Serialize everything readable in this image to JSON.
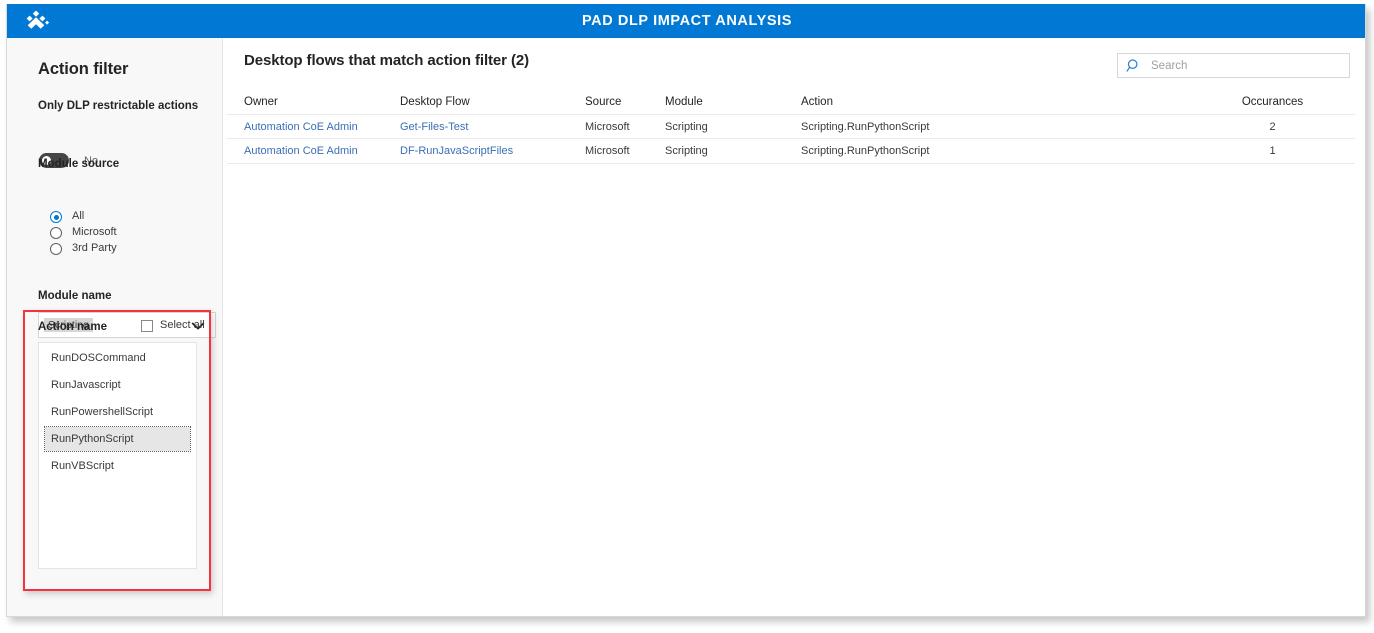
{
  "app": {
    "banner_title": "PAD DLP IMPACT ANALYSIS",
    "logo_name": "power-platform-coe-logo",
    "accent_color": "#0078d4",
    "highlight_color": "#f5333f"
  },
  "sidebar": {
    "title": "Action filter",
    "dlp_filter": {
      "label": "Only DLP restrictable actions",
      "toggle_value": "No",
      "toggle_on": false
    },
    "module_source": {
      "label": "Module source",
      "options": [
        {
          "label": "All",
          "selected": true
        },
        {
          "label": "Microsoft",
          "selected": false
        },
        {
          "label": "3rd Party",
          "selected": false
        }
      ]
    },
    "module_name": {
      "label": "Module name",
      "selected": "Scripting",
      "chevron_icon": "chevron-down-icon"
    },
    "action_name": {
      "label": "Action name",
      "select_all_label": "Select all",
      "select_all_checked": false,
      "items": [
        {
          "label": "RunDOSCommand",
          "selected": false
        },
        {
          "label": "RunJavascript",
          "selected": false
        },
        {
          "label": "RunPowershellScript",
          "selected": false
        },
        {
          "label": "RunPythonScript",
          "selected": true
        },
        {
          "label": "RunVBScript",
          "selected": false
        }
      ]
    }
  },
  "main": {
    "title": "Desktop flows that match action filter (2)",
    "search": {
      "placeholder": "Search",
      "value": "",
      "icon": "search-icon"
    },
    "table": {
      "columns": [
        "Owner",
        "Desktop Flow",
        "Source",
        "Module",
        "Action",
        "Occurances"
      ],
      "rows": [
        {
          "owner": "Automation CoE Admin",
          "desktop_flow": "Get-Files-Test",
          "source": "Microsoft",
          "module": "Scripting",
          "action": "Scripting.RunPythonScript",
          "occurances": "2"
        },
        {
          "owner": "Automation CoE Admin",
          "desktop_flow": "DF-RunJavaScriptFiles",
          "source": "Microsoft",
          "module": "Scripting",
          "action": "Scripting.RunPythonScript",
          "occurances": "1"
        }
      ]
    }
  }
}
